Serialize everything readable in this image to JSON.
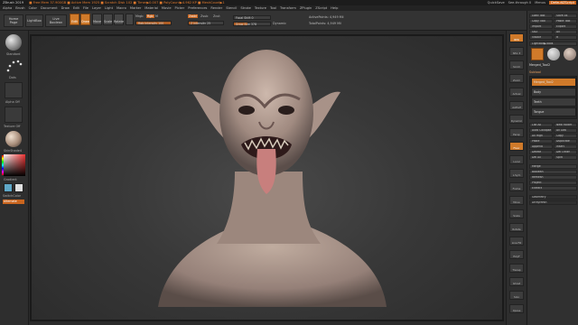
{
  "titlebar": {
    "title": "ZBrush 2019",
    "stats": "■ Free Mem 37.900GB ■ Active Mem 1925 ■ Scratch Disk 102 ■ Timer▶0.007 ■ PolyCount▶4.962 KP ■ MeshCount▶1",
    "quicksave": "QuickSave",
    "see_through": "See-through 0",
    "menus_label": "Menus",
    "script_label": "DefaultZScript"
  },
  "menus": [
    "Alpha",
    "Brush",
    "Color",
    "Document",
    "Draw",
    "Edit",
    "File",
    "Layer",
    "Light",
    "Macro",
    "Marker",
    "Material",
    "Movie",
    "Picker",
    "Preferences",
    "Render",
    "Stencil",
    "Stroke",
    "Texture",
    "Tool",
    "Transform",
    "ZPlugin",
    "ZScript",
    "Help"
  ],
  "toolbar": {
    "home_page": "Home Page",
    "lightbox": "LightBox",
    "live_boolean": "Live Boolean",
    "edit": "Edit",
    "draw": "Draw",
    "move": "Move",
    "scale": "Scale",
    "rotate": "Rotate",
    "mrgb": "Mrgb",
    "rgb": "Rgb",
    "m": "M",
    "zadd": "Zadd",
    "zsub": "Zsub",
    "zcut": "Zcut",
    "rgb_intensity": "Rgb Intensity 100",
    "z_intensity": "Z Intensity 25",
    "focal_shift": "Focal Shift 0",
    "draw_size": "Draw Size 378",
    "dynamic": "Dynamic",
    "active_points": "ActivePoints: 4,949 Mil",
    "total_points": "TotalPoints: 4,949 Mil",
    "rgb_intensity_pct": 100,
    "z_intensity_pct": 25,
    "draw_size_pct": 38
  },
  "leftshelf": {
    "standard": "Standard",
    "dots": "Dots",
    "alpha_off": "Alpha Off",
    "texture_off": "Texture Off",
    "skin_shade": "SkinShade4",
    "gradient": "Gradient",
    "switch_color": "SwitchColor",
    "alternate": "Alternate",
    "main_color": "#5fa8c8",
    "secondary_color": "#e0e0e0"
  },
  "rightstrip": [
    "BPR",
    "SPix 3",
    "Scroll",
    "Zoom",
    "Actual",
    "AAHalf",
    "Dynamic",
    "Persp",
    "Floor",
    "Local",
    "L.Sym",
    "Frame",
    "Move",
    "Scale",
    "Rotate",
    "Line Fill",
    "PolyF",
    "Transp",
    "Ghost",
    "Solo",
    "Xpose"
  ],
  "tray": {
    "load_tool": "Load Tool",
    "save_as": "Save As",
    "copy_tool": "Copy Tool",
    "paste_tool": "Paste Tool",
    "import": "Import",
    "export": "Export",
    "goz": "GoZ",
    "all": "All",
    "visible": "Visible",
    "r": "R",
    "lightbox_tools": "Lightbox▶Tools",
    "current_tool": "Merged_Tool2",
    "subtool": "Subtool",
    "subtools": [
      "Merged_Tool2",
      "Body",
      "Teeth",
      "Tongue"
    ],
    "list_all": "List All",
    "new_folder": "New Folder",
    "auto_collapse": "Auto Collapse",
    "all_low": "All Low",
    "all_high": "All High",
    "copy": "Copy",
    "paste": "Paste",
    "duplicate": "Duplicate",
    "append": "Append",
    "insert": "Insert",
    "delete": "Delete",
    "del_other": "Del Other",
    "del_all": "Del All",
    "split": "Split",
    "merge": "Merge",
    "boolean": "Boolean",
    "remesh": "Remesh",
    "project": "Project",
    "extract": "Extract",
    "geometry": "Geometry",
    "array_mesh": "ArrayMesh"
  }
}
